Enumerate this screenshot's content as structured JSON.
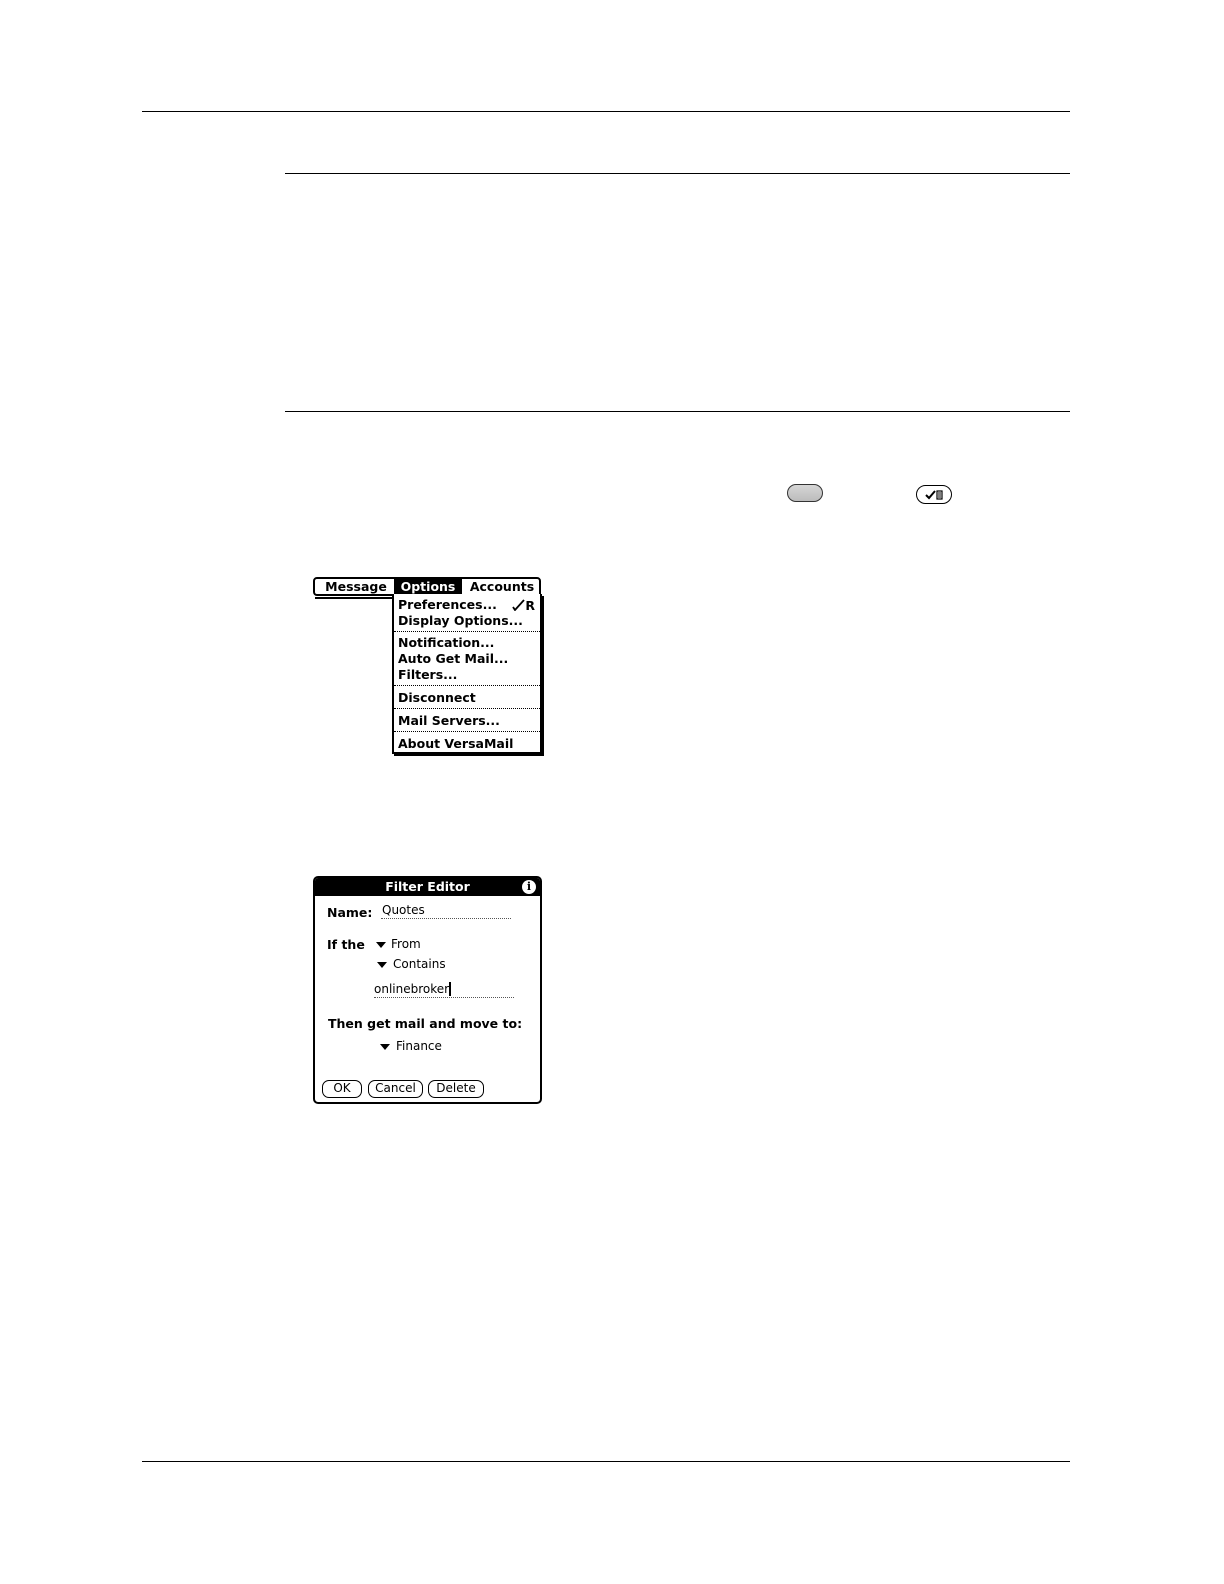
{
  "menu": {
    "tabs": [
      "Message",
      "Options",
      "Accounts"
    ],
    "items": [
      "Preferences...",
      "Display Options...",
      "Notification...",
      "Auto Get Mail...",
      "Filters...",
      "Disconnect",
      "Mail Servers...",
      "About VersaMail"
    ],
    "shortcut": "R"
  },
  "filter_editor": {
    "title": "Filter Editor",
    "info_glyph": "i",
    "name_label": "Name:",
    "name_value": "Quotes",
    "if_label": "If the",
    "field_value": "From",
    "operator_value": "Contains",
    "match_value": "onlinebroker",
    "then_label": "Then get mail and move to:",
    "folder_value": "Finance",
    "buttons": {
      "ok": "OK",
      "cancel": "Cancel",
      "delete": "Delete"
    }
  }
}
